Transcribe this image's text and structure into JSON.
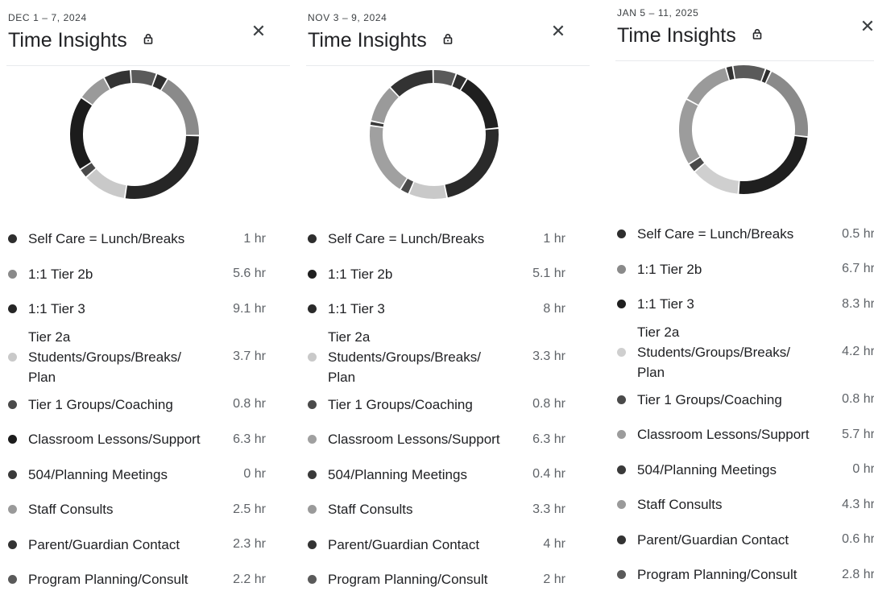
{
  "panels": [
    {
      "date": "DEC 1 – 7, 2024",
      "title": "Time Insights",
      "items": [
        {
          "label": "Self Care = Lunch/Breaks",
          "value": "1 hr",
          "hours": 1,
          "color": "#2e2e2e"
        },
        {
          "label": "1:1 Tier 2b",
          "value": "5.6 hr",
          "hours": 5.6,
          "color": "#8a8a8a"
        },
        {
          "label": "1:1 Tier 3",
          "value": "9.1 hr",
          "hours": 9.1,
          "color": "#262626"
        },
        {
          "label": "Tier 2a Students/Groups/Breaks/ Plan",
          "value": "3.7 hr",
          "hours": 3.7,
          "color": "#c9c9c9"
        },
        {
          "label": "Tier 1 Groups/Coaching",
          "value": "0.8 hr",
          "hours": 0.8,
          "color": "#4a4a4a"
        },
        {
          "label": "Classroom Lessons/Support",
          "value": "6.3 hr",
          "hours": 6.3,
          "color": "#1c1c1c"
        },
        {
          "label": "504/Planning Meetings",
          "value": "0 hr",
          "hours": 0,
          "color": "#3a3a3a"
        },
        {
          "label": "Staff Consults",
          "value": "2.5 hr",
          "hours": 2.5,
          "color": "#9a9a9a"
        },
        {
          "label": "Parent/Guardian Contact",
          "value": "2.3 hr",
          "hours": 2.3,
          "color": "#333333"
        },
        {
          "label": "Program Planning/Consult",
          "value": "2.2 hr",
          "hours": 2.2,
          "color": "#5a5a5a"
        }
      ]
    },
    {
      "date": "NOV 3 – 9, 2024",
      "title": "Time Insights",
      "items": [
        {
          "label": "Self Care = Lunch/Breaks",
          "value": "1 hr",
          "hours": 1,
          "color": "#2e2e2e"
        },
        {
          "label": "1:1 Tier 2b",
          "value": "5.1 hr",
          "hours": 5.1,
          "color": "#1f1f1f"
        },
        {
          "label": "1:1 Tier 3",
          "value": "8 hr",
          "hours": 8,
          "color": "#2a2a2a"
        },
        {
          "label": "Tier 2a Students/Groups/Breaks/ Plan",
          "value": "3.3 hr",
          "hours": 3.3,
          "color": "#c9c9c9"
        },
        {
          "label": "Tier 1 Groups/Coaching",
          "value": "0.8 hr",
          "hours": 0.8,
          "color": "#4a4a4a"
        },
        {
          "label": "Classroom Lessons/Support",
          "value": "6.3 hr",
          "hours": 6.3,
          "color": "#a0a0a0"
        },
        {
          "label": "504/Planning Meetings",
          "value": "0.4 hr",
          "hours": 0.4,
          "color": "#3a3a3a"
        },
        {
          "label": "Staff Consults",
          "value": "3.3 hr",
          "hours": 3.3,
          "color": "#9a9a9a"
        },
        {
          "label": "Parent/Guardian Contact",
          "value": "4 hr",
          "hours": 4,
          "color": "#333333"
        },
        {
          "label": "Program Planning/Consult",
          "value": "2 hr",
          "hours": 2,
          "color": "#5a5a5a"
        }
      ]
    },
    {
      "date": "JAN 5 – 11, 2025",
      "title": "Time Insights",
      "items": [
        {
          "label": "Self Care = Lunch/Breaks",
          "value": "0.5 hr",
          "hours": 0.5,
          "color": "#2e2e2e"
        },
        {
          "label": "1:1 Tier 2b",
          "value": "6.7 hr",
          "hours": 6.7,
          "color": "#8a8a8a"
        },
        {
          "label": "1:1 Tier 3",
          "value": "8.3 hr",
          "hours": 8.3,
          "color": "#1f1f1f"
        },
        {
          "label": "Tier 2a Students/Groups/Breaks/ Plan",
          "value": "4.2 hr",
          "hours": 4.2,
          "color": "#cfcfcf"
        },
        {
          "label": "Tier 1 Groups/Coaching",
          "value": "0.8 hr",
          "hours": 0.8,
          "color": "#4a4a4a"
        },
        {
          "label": "Classroom Lessons/Support",
          "value": "5.7 hr",
          "hours": 5.7,
          "color": "#9c9c9c"
        },
        {
          "label": "504/Planning Meetings",
          "value": "0 hr",
          "hours": 0,
          "color": "#3a3a3a"
        },
        {
          "label": "Staff Consults",
          "value": "4.3 hr",
          "hours": 4.3,
          "color": "#9a9a9a"
        },
        {
          "label": "Parent/Guardian Contact",
          "value": "0.6 hr",
          "hours": 0.6,
          "color": "#333333"
        },
        {
          "label": "Program Planning/Consult",
          "value": "2.8 hr",
          "hours": 2.8,
          "color": "#5a5a5a"
        }
      ]
    }
  ]
}
